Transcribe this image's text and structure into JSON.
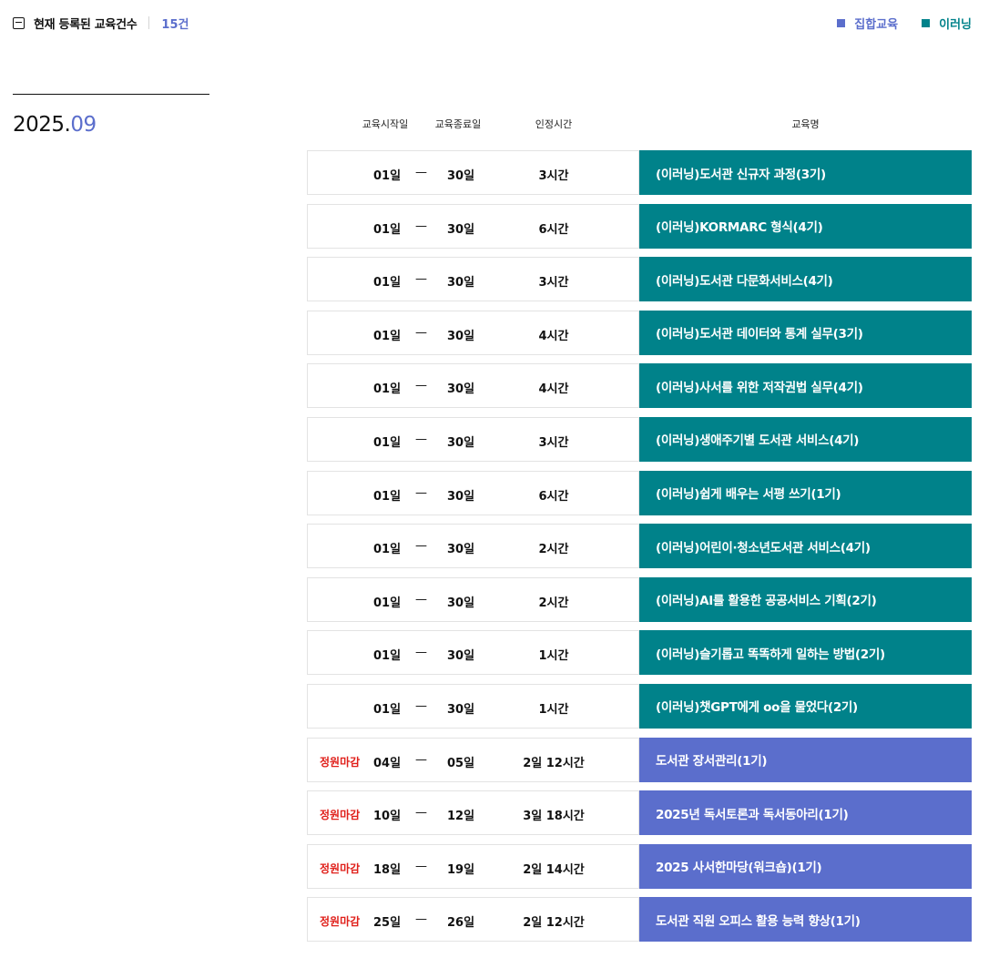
{
  "header": {
    "title": "현재 등록된 교육건수",
    "count": "15건",
    "legend": {
      "group_label": "집합교육",
      "elearning_label": "이러닝"
    }
  },
  "colors": {
    "group": "#5b6ecc",
    "elearning": "#00828a",
    "closed": "#e0201b"
  },
  "month": {
    "year": "2025.",
    "month": "09"
  },
  "columns": {
    "start": "교육시작일",
    "end": "교육종료일",
    "hours": "인정시간",
    "name": "교육명"
  },
  "courses": [
    {
      "type": "elearning",
      "status": "",
      "start": "01일",
      "dash": "—",
      "end": "30일",
      "hours": "3시간",
      "name": "(이러닝)도서관 신규자 과정(3기)"
    },
    {
      "type": "elearning",
      "status": "",
      "start": "01일",
      "dash": "—",
      "end": "30일",
      "hours": "6시간",
      "name": "(이러닝)KORMARC 형식(4기)"
    },
    {
      "type": "elearning",
      "status": "",
      "start": "01일",
      "dash": "—",
      "end": "30일",
      "hours": "3시간",
      "name": "(이러닝)도서관 다문화서비스(4기)"
    },
    {
      "type": "elearning",
      "status": "",
      "start": "01일",
      "dash": "—",
      "end": "30일",
      "hours": "4시간",
      "name": "(이러닝)도서관 데이터와 통계 실무(3기)"
    },
    {
      "type": "elearning",
      "status": "",
      "start": "01일",
      "dash": "—",
      "end": "30일",
      "hours": "4시간",
      "name": "(이러닝)사서를 위한 저작권법 실무(4기)"
    },
    {
      "type": "elearning",
      "status": "",
      "start": "01일",
      "dash": "—",
      "end": "30일",
      "hours": "3시간",
      "name": "(이러닝)생애주기별 도서관 서비스(4기)"
    },
    {
      "type": "elearning",
      "status": "",
      "start": "01일",
      "dash": "—",
      "end": "30일",
      "hours": "6시간",
      "name": "(이러닝)쉽게 배우는 서평 쓰기(1기)"
    },
    {
      "type": "elearning",
      "status": "",
      "start": "01일",
      "dash": "—",
      "end": "30일",
      "hours": "2시간",
      "name": "(이러닝)어린이·청소년도서관 서비스(4기)"
    },
    {
      "type": "elearning",
      "status": "",
      "start": "01일",
      "dash": "—",
      "end": "30일",
      "hours": "2시간",
      "name": "(이러닝)AI를 활용한 공공서비스 기획(2기)"
    },
    {
      "type": "elearning",
      "status": "",
      "start": "01일",
      "dash": "—",
      "end": "30일",
      "hours": "1시간",
      "name": "(이러닝)슬기롭고 똑똑하게 일하는 방법(2기)"
    },
    {
      "type": "elearning",
      "status": "",
      "start": "01일",
      "dash": "—",
      "end": "30일",
      "hours": "1시간",
      "name": "(이러닝)챗GPT에게 oo을 물었다(2기)"
    },
    {
      "type": "group",
      "status": "정원마감",
      "start": "04일",
      "dash": "—",
      "end": "05일",
      "hours": "2일 12시간",
      "name": "도서관 장서관리(1기)"
    },
    {
      "type": "group",
      "status": "정원마감",
      "start": "10일",
      "dash": "—",
      "end": "12일",
      "hours": "3일 18시간",
      "name": "2025년 독서토론과 독서동아리(1기)"
    },
    {
      "type": "group",
      "status": "정원마감",
      "start": "18일",
      "dash": "—",
      "end": "19일",
      "hours": "2일 14시간",
      "name": "2025 사서한마당(워크숍)(1기)"
    },
    {
      "type": "group",
      "status": "정원마감",
      "start": "25일",
      "dash": "—",
      "end": "26일",
      "hours": "2일 12시간",
      "name": "도서관 직원 오피스 활용 능력 향상(1기)"
    }
  ]
}
